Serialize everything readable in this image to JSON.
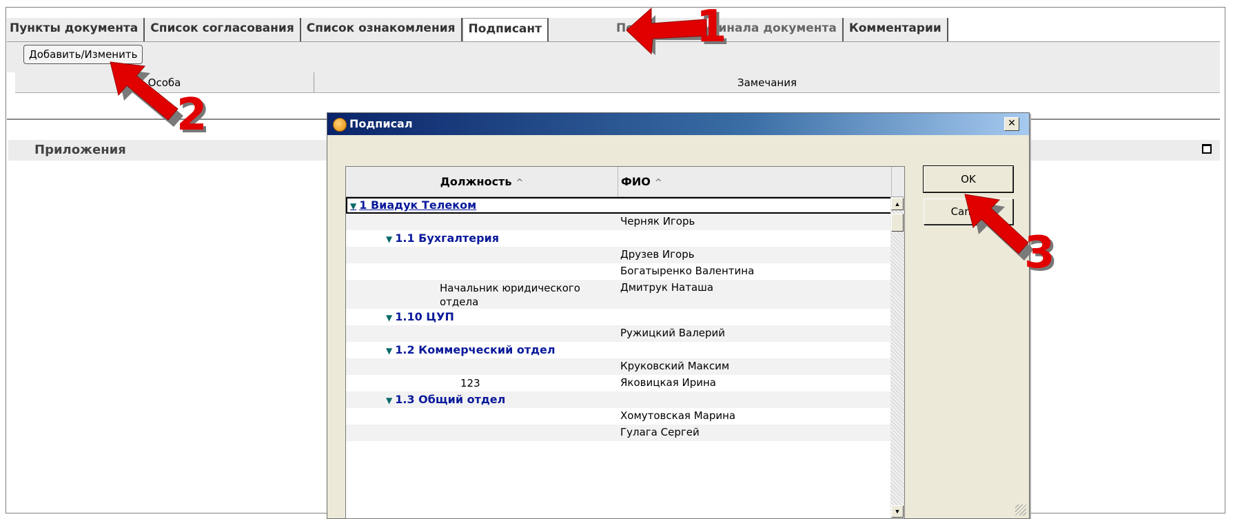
{
  "tabs": {
    "items": [
      {
        "label": "Пункты документа"
      },
      {
        "label": "Список согласования"
      },
      {
        "label": "Список ознакомления"
      },
      {
        "label": "Подписант"
      },
      {
        "label": "Передача оригинала документа"
      },
      {
        "label": "Комментарии"
      }
    ]
  },
  "toolbar": {
    "add_label": "Добавить/Изменить"
  },
  "grid": {
    "col_person": "Особа",
    "col_remarks": "Замечания"
  },
  "attachments": {
    "title": "Приложения"
  },
  "dialog": {
    "title": "Подписал",
    "close_glyph": "✕",
    "columns": {
      "position": "Должность",
      "fio": "ФИО",
      "sort_glyph": "^"
    },
    "ok_label": "OK",
    "cancel_label": "Cancel",
    "rows": [
      {
        "type": "group",
        "level": 0,
        "text": "1 Виадук Телеком"
      },
      {
        "type": "person",
        "position": "",
        "fio": "Черняк Игорь"
      },
      {
        "type": "group",
        "level": 1,
        "text": "1.1 Бухгалтерия"
      },
      {
        "type": "person",
        "position": "",
        "fio": "Друзев Игорь"
      },
      {
        "type": "person",
        "position": "",
        "fio": "Богатыренко Валентина"
      },
      {
        "type": "person",
        "position": "Начальник юридического отдела",
        "fio": "Дмитрук Наташа"
      },
      {
        "type": "group",
        "level": 1,
        "text": "1.10 ЦУП"
      },
      {
        "type": "person",
        "position": "",
        "fio": "Ружицкий Валерий"
      },
      {
        "type": "group",
        "level": 1,
        "text": "1.2 Коммерческий отдел"
      },
      {
        "type": "person",
        "position": "",
        "fio": "Круковский Максим"
      },
      {
        "type": "person",
        "position": "123",
        "fio": "Яковицкая Ирина"
      },
      {
        "type": "group",
        "level": 1,
        "text": "1.3 Общий отдел"
      },
      {
        "type": "person",
        "position": "",
        "fio": "Хомутовская Марина"
      },
      {
        "type": "person",
        "position": "",
        "fio": "Гулага Сергей"
      }
    ]
  },
  "callouts": [
    {
      "number": "1",
      "color": "#e00000"
    },
    {
      "number": "2",
      "color": "#e00000"
    },
    {
      "number": "3",
      "color": "#e00000"
    }
  ]
}
